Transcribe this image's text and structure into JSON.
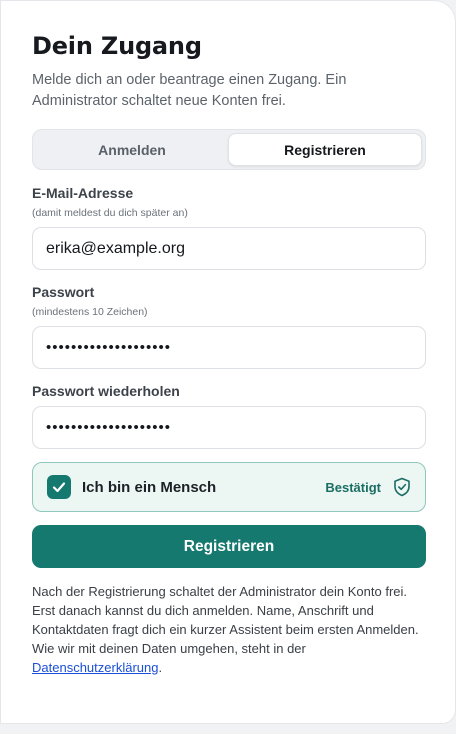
{
  "header": {
    "title": "Dein Zugang",
    "subtitle": "Melde dich an oder beantrage einen Zugang. Ein Administrator schaltet neue Konten frei."
  },
  "tabs": [
    {
      "label": "Anmelden",
      "active": false
    },
    {
      "label": "Registrieren",
      "active": true
    }
  ],
  "form": {
    "email": {
      "label": "E-Mail-Adresse",
      "hint": "(damit meldest du dich später an)",
      "value": "erika@example.org"
    },
    "password": {
      "label": "Passwort",
      "hint": "(mindestens 10 Zeichen)",
      "value": "••••••••••••••••••••"
    },
    "password_repeat": {
      "label": "Passwort wiederholen",
      "value": "••••••••••••••••••••"
    },
    "captcha": {
      "label": "Ich bin ein Mensch",
      "status": "Bestätigt",
      "checked": true
    },
    "submit_label": "Registrieren"
  },
  "footer": {
    "text": "Nach der Registrierung schaltet der Administrator dein Konto frei. Erst danach kannst du dich anmelden. Name, Anschrift und Kontaktdaten fragt dich ein kurzer Assistent beim ersten Anmelden. Wie wir mit deinen Daten umgehen, steht in der ",
    "link_label": "Datenschutzerklärung",
    "suffix": "."
  },
  "colors": {
    "accent": "#16796f",
    "captcha_bg": "#ecf6f3",
    "link": "#1a4fd6"
  },
  "icons": {
    "checkbox": "check-icon",
    "status": "shield-check-icon"
  }
}
